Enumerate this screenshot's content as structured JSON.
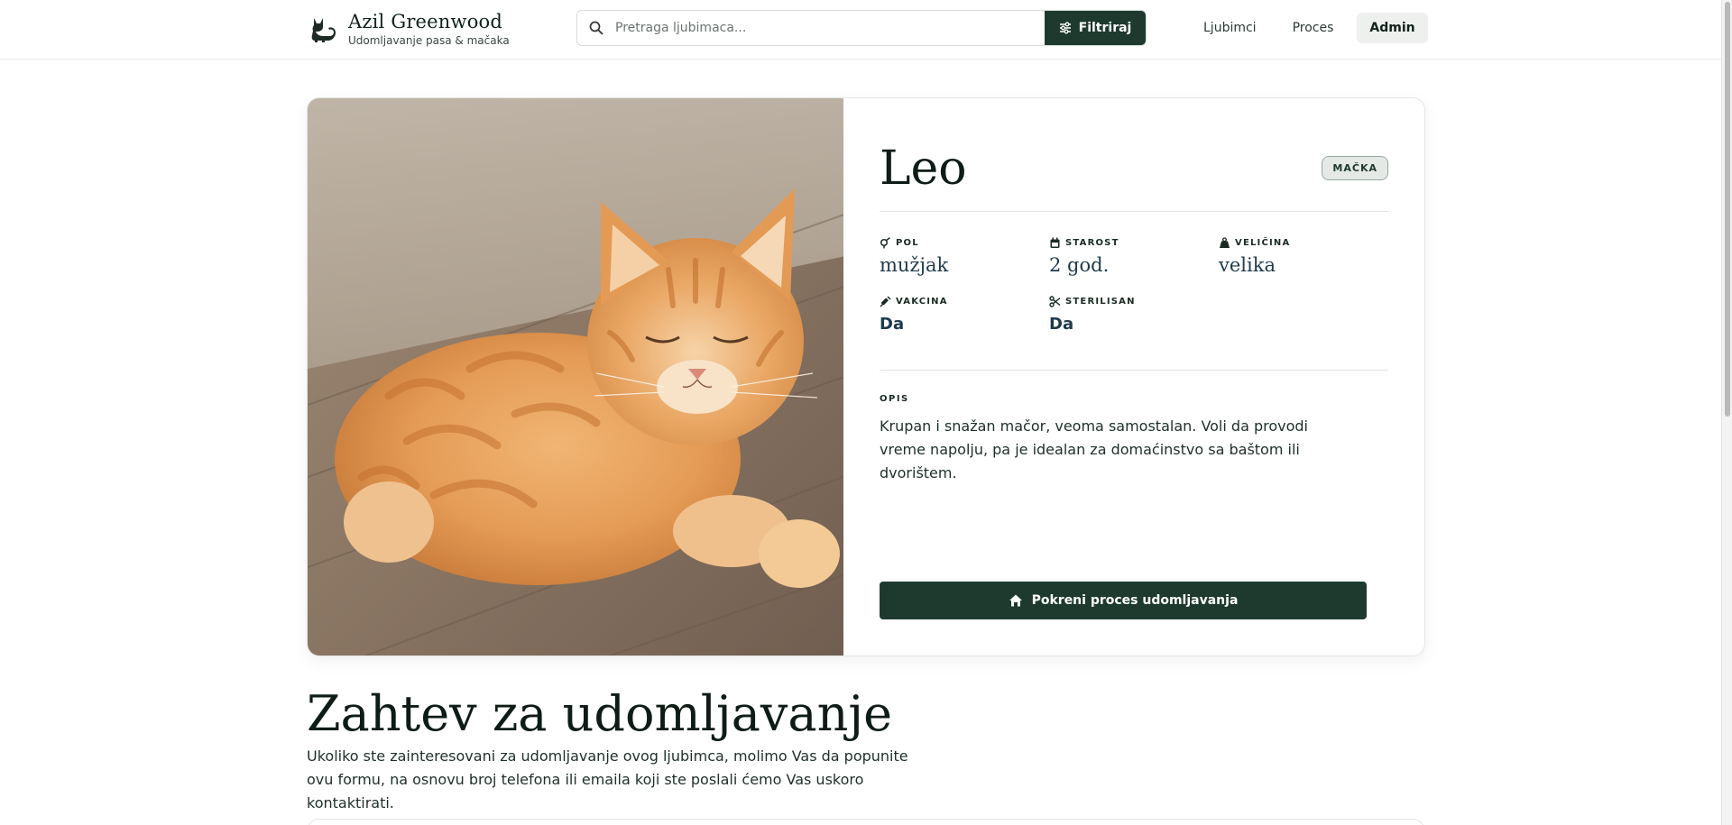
{
  "brand": {
    "title": "Azil Greenwood",
    "subtitle": "Udomljavanje pasa & mačaka",
    "logo_icon": "cat-logo-icon"
  },
  "search": {
    "placeholder": "Pretraga ljubimaca...",
    "icon": "search-icon"
  },
  "filter": {
    "label": "Filtriraj",
    "icon": "sliders-icon"
  },
  "nav": {
    "items": [
      {
        "label": "Ljubimci"
      },
      {
        "label": "Proces"
      },
      {
        "label": "Admin",
        "active": true
      }
    ]
  },
  "pet": {
    "name": "Leo",
    "species": "MAČKA",
    "photo_icon": "orange-tabby-cat-photo",
    "attributes": [
      {
        "label": "POL",
        "value": "mužjak",
        "icon": "gender-icon"
      },
      {
        "label": "STAROST",
        "value": "2 god.",
        "icon": "calendar-icon"
      },
      {
        "label": "VELIČINA",
        "value": "velika",
        "icon": "weight-icon"
      },
      {
        "label": "VAKCINA",
        "value": "Da",
        "icon": "syringe-icon"
      },
      {
        "label": "STERILISAN",
        "value": "Da",
        "icon": "scissors-icon"
      }
    ],
    "description_label": "OPIS",
    "description": "Krupan i snažan mačor, veoma samostalan. Voli da provodi vreme napolju, pa je idealan za domaćinstvo sa baštom ili dvorištem.",
    "adopt_button": "Pokreni proces udomljavanja",
    "adopt_icon": "home-icon"
  },
  "request": {
    "title": "Zahtev za udomljavanje",
    "text": "Ukoliko ste zainteresovani za udomljavanje ovog ljubimca, molimo Vas da popunite ovu formu, na osnovu broj telefona ili emaila koji ste poslali ćemo Vas uskoro kontaktirati."
  },
  "colors": {
    "primary": "#1e3a2f",
    "badge_bg": "#e4e9e6",
    "value_text": "#1e3a4a"
  }
}
